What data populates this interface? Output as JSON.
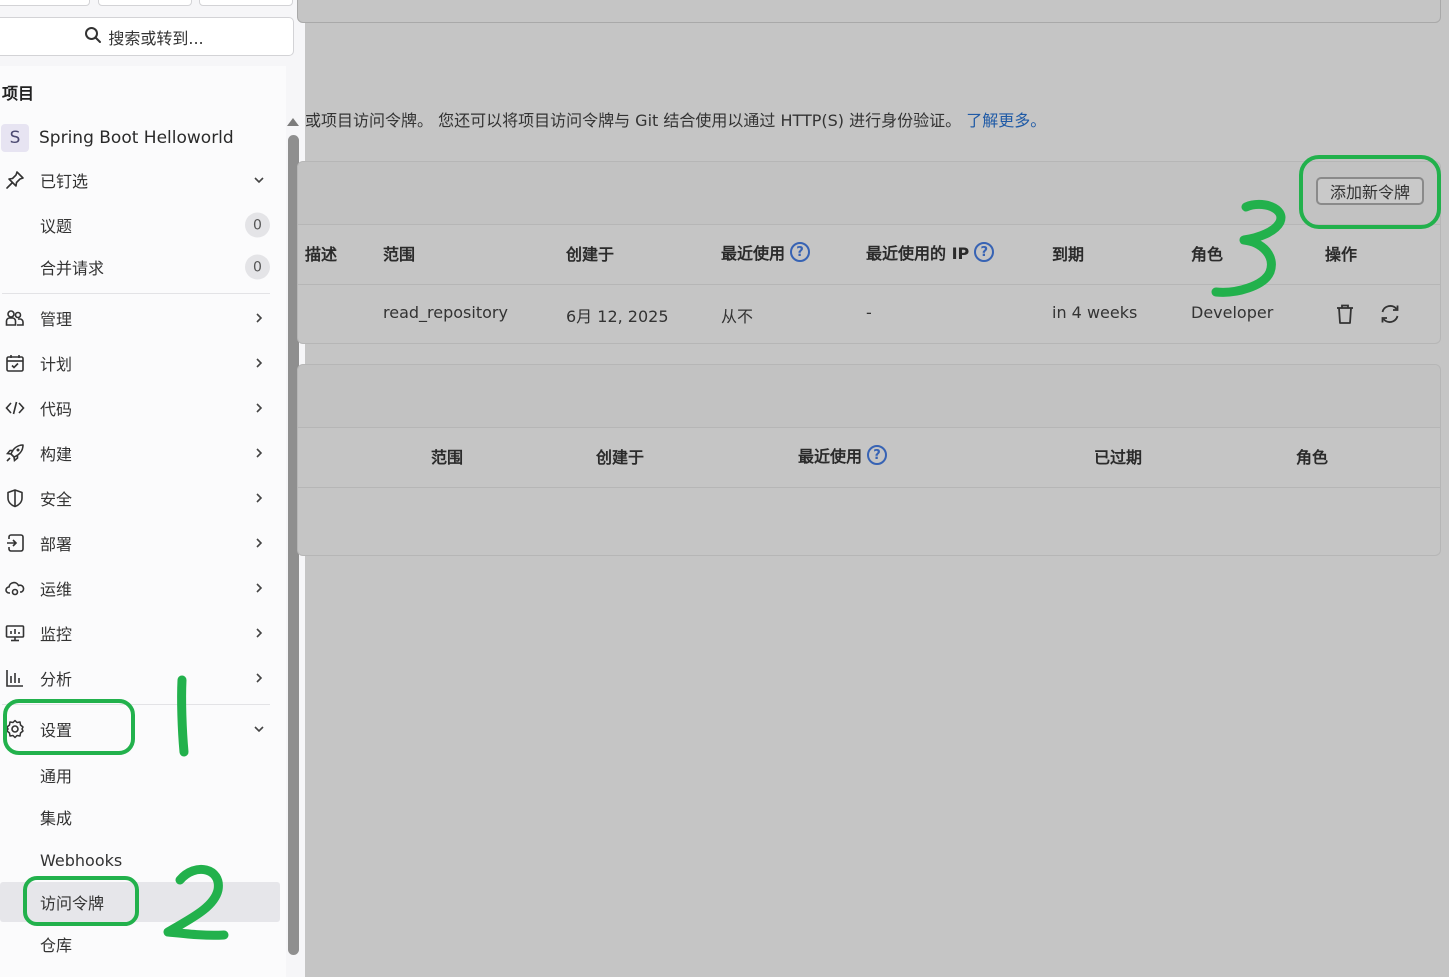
{
  "sidebar": {
    "search_placeholder": "搜索或转到...",
    "section_title": "项目",
    "project": {
      "avatar_letter": "S",
      "name": "Spring Boot Helloworld"
    },
    "pinned": {
      "label": "已钉选",
      "items": [
        {
          "label": "议题",
          "count": "0"
        },
        {
          "label": "合并请求",
          "count": "0"
        }
      ]
    },
    "menu": [
      {
        "label": "管理",
        "icon": "users-icon"
      },
      {
        "label": "计划",
        "icon": "calendar-icon"
      },
      {
        "label": "代码",
        "icon": "code-icon"
      },
      {
        "label": "构建",
        "icon": "rocket-icon"
      },
      {
        "label": "安全",
        "icon": "shield-icon"
      },
      {
        "label": "部署",
        "icon": "deploy-icon"
      },
      {
        "label": "运维",
        "icon": "cloud-gear-icon"
      },
      {
        "label": "监控",
        "icon": "monitor-icon"
      },
      {
        "label": "分析",
        "icon": "chart-icon"
      }
    ],
    "settings": {
      "label": "设置",
      "items": [
        {
          "label": "通用"
        },
        {
          "label": "集成"
        },
        {
          "label": "Webhooks"
        },
        {
          "label": "访问令牌",
          "active": true
        },
        {
          "label": "仓库"
        }
      ]
    }
  },
  "main": {
    "description": "或项目访问令牌。 您还可以将项目访问令牌与 Git 结合使用以通过 HTTP(S) 进行身份验证。",
    "learn_more": "了解更多。",
    "add_token_button": "添加新令牌",
    "active_tokens": {
      "headers": {
        "description": "描述",
        "scope": "范围",
        "created": "创建于",
        "last_used": "最近使用",
        "last_used_ip": "最近使用的 IP",
        "expires": "到期",
        "role": "角色",
        "actions": "操作"
      },
      "rows": [
        {
          "scope": "read_repository",
          "created": "6月 12, 2025",
          "last_used": "从不",
          "last_used_ip": "-",
          "expires": "in 4 weeks",
          "role": "Developer"
        }
      ]
    },
    "inactive_tokens": {
      "headers": {
        "scope": "范围",
        "created": "创建于",
        "last_used": "最近使用",
        "expired": "已过期",
        "role": "角色"
      }
    },
    "help_glyph": "?"
  },
  "annotations": {
    "marks": [
      "1",
      "2",
      "3"
    ],
    "color": "#22b14c"
  },
  "colors": {
    "link": "#1f5aa6",
    "help": "#3763b4",
    "overlay": "#c5c5c5"
  }
}
